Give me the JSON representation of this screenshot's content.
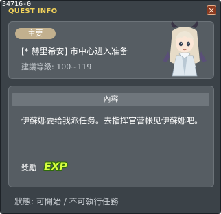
{
  "window": {
    "quest_id": "34716-0",
    "title": "QUEST INFO",
    "close_icon": "×"
  },
  "quest": {
    "badge": "主要",
    "name": "[* 赫里希安] 市中心进入准备",
    "level_label": "建議等級:",
    "level_range": "100~119"
  },
  "content": {
    "header": "內容",
    "description": "伊蘇娜要给我派任务。去指挥官营帐见伊蘇娜吧。"
  },
  "reward": {
    "label": "獎勵",
    "exp_icon": "EXP"
  },
  "status": {
    "label": "狀態:",
    "value": "可開始 / 不可執行任務"
  },
  "colors": {
    "window_bg": "#3b4248",
    "panel_bg": "#565d63",
    "title_yellow": "#f2d25a",
    "badge_bg": "#c2b08e",
    "exp_green": "#d8ff40"
  },
  "icons": {
    "close": "close-icon",
    "npc": "npc-portrait",
    "exp": "exp-icon"
  }
}
